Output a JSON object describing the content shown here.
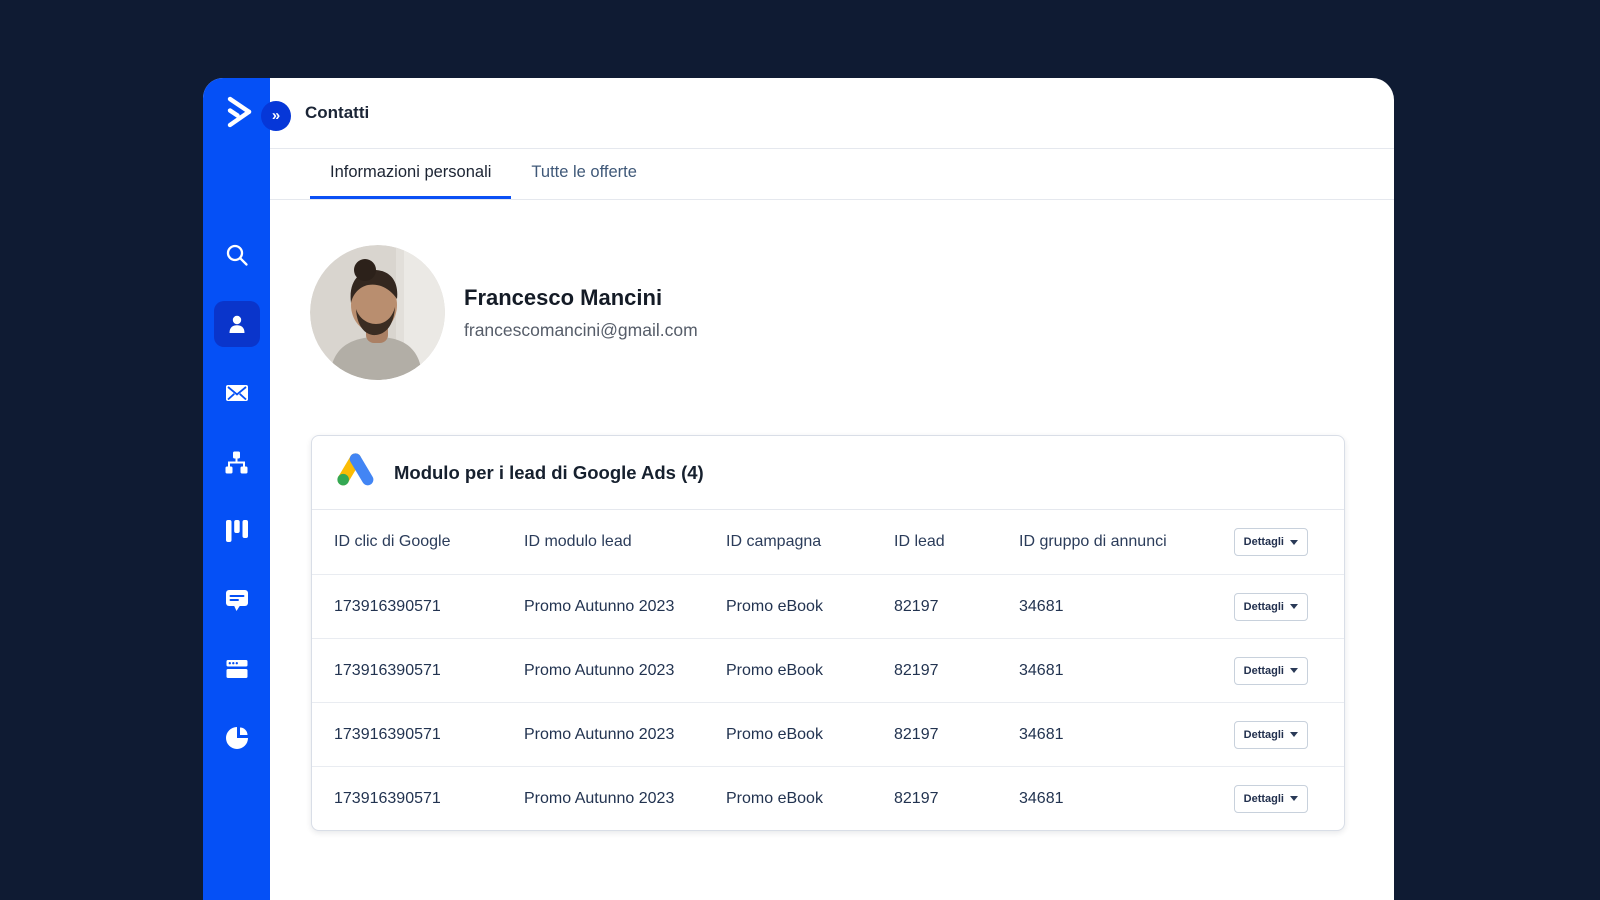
{
  "colors": {
    "page_bg": "#0f1b33",
    "sidebar_blue": "#0550f6",
    "sidebar_active_blue": "#0a35cb",
    "accent_blue": "#0b50f5",
    "google_yellow": "#FBBC04",
    "google_blue": "#4285F4",
    "google_green": "#34A853"
  },
  "sidebar": {
    "logo_icon": "activecampaign-logo",
    "collapse_icon": "»",
    "items": [
      {
        "icon": "search-icon",
        "active": false
      },
      {
        "icon": "contact-icon",
        "active": true
      },
      {
        "icon": "email-icon",
        "active": false
      },
      {
        "icon": "automation-sitemap-icon",
        "active": false
      },
      {
        "icon": "kanban-board-icon",
        "active": false
      },
      {
        "icon": "chat-bubble-icon",
        "active": false
      },
      {
        "icon": "form-window-icon",
        "active": false
      },
      {
        "icon": "pie-chart-icon",
        "active": false
      }
    ]
  },
  "header": {
    "title": "Contatti"
  },
  "tabs": [
    {
      "label": "Informazioni personali",
      "active": true
    },
    {
      "label": "Tutte le offerte",
      "active": false
    }
  ],
  "contact": {
    "name": "Francesco Mancini",
    "email": "francescomancini@gmail.com",
    "avatar_icon": "man-with-bun-photo"
  },
  "leads_card": {
    "logo_icon": "google-ads-logo",
    "title": "Modulo per i lead di Google Ads (4)",
    "details_label": "Dettagli",
    "columns": [
      "ID clic di Google",
      "ID modulo lead",
      "ID campagna",
      "ID lead",
      "ID gruppo di annunci"
    ],
    "rows": [
      [
        "173916390571",
        "Promo Autunno 2023",
        "Promo eBook",
        "82197",
        "34681"
      ],
      [
        "173916390571",
        "Promo Autunno 2023",
        "Promo eBook",
        "82197",
        "34681"
      ],
      [
        "173916390571",
        "Promo Autunno 2023",
        "Promo eBook",
        "82197",
        "34681"
      ],
      [
        "173916390571",
        "Promo Autunno 2023",
        "Promo eBook",
        "82197",
        "34681"
      ]
    ]
  }
}
